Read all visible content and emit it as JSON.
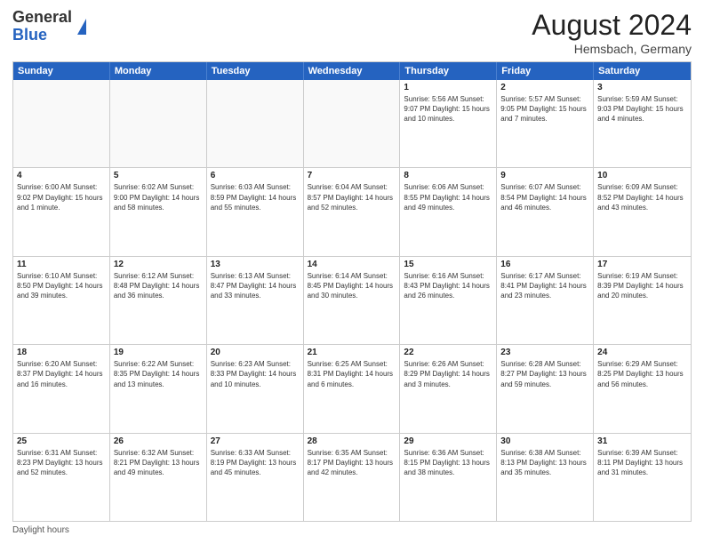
{
  "header": {
    "logo": {
      "line1": "General",
      "line2": "Blue"
    },
    "title": "August 2024",
    "subtitle": "Hemsbach, Germany"
  },
  "days_of_week": [
    "Sunday",
    "Monday",
    "Tuesday",
    "Wednesday",
    "Thursday",
    "Friday",
    "Saturday"
  ],
  "weeks": [
    [
      {
        "day": "",
        "empty": true
      },
      {
        "day": "",
        "empty": true
      },
      {
        "day": "",
        "empty": true
      },
      {
        "day": "",
        "empty": true
      },
      {
        "day": "1",
        "info": "Sunrise: 5:56 AM\nSunset: 9:07 PM\nDaylight: 15 hours\nand 10 minutes."
      },
      {
        "day": "2",
        "info": "Sunrise: 5:57 AM\nSunset: 9:05 PM\nDaylight: 15 hours\nand 7 minutes."
      },
      {
        "day": "3",
        "info": "Sunrise: 5:59 AM\nSunset: 9:03 PM\nDaylight: 15 hours\nand 4 minutes."
      }
    ],
    [
      {
        "day": "4",
        "info": "Sunrise: 6:00 AM\nSunset: 9:02 PM\nDaylight: 15 hours\nand 1 minute."
      },
      {
        "day": "5",
        "info": "Sunrise: 6:02 AM\nSunset: 9:00 PM\nDaylight: 14 hours\nand 58 minutes."
      },
      {
        "day": "6",
        "info": "Sunrise: 6:03 AM\nSunset: 8:59 PM\nDaylight: 14 hours\nand 55 minutes."
      },
      {
        "day": "7",
        "info": "Sunrise: 6:04 AM\nSunset: 8:57 PM\nDaylight: 14 hours\nand 52 minutes."
      },
      {
        "day": "8",
        "info": "Sunrise: 6:06 AM\nSunset: 8:55 PM\nDaylight: 14 hours\nand 49 minutes."
      },
      {
        "day": "9",
        "info": "Sunrise: 6:07 AM\nSunset: 8:54 PM\nDaylight: 14 hours\nand 46 minutes."
      },
      {
        "day": "10",
        "info": "Sunrise: 6:09 AM\nSunset: 8:52 PM\nDaylight: 14 hours\nand 43 minutes."
      }
    ],
    [
      {
        "day": "11",
        "info": "Sunrise: 6:10 AM\nSunset: 8:50 PM\nDaylight: 14 hours\nand 39 minutes."
      },
      {
        "day": "12",
        "info": "Sunrise: 6:12 AM\nSunset: 8:48 PM\nDaylight: 14 hours\nand 36 minutes."
      },
      {
        "day": "13",
        "info": "Sunrise: 6:13 AM\nSunset: 8:47 PM\nDaylight: 14 hours\nand 33 minutes."
      },
      {
        "day": "14",
        "info": "Sunrise: 6:14 AM\nSunset: 8:45 PM\nDaylight: 14 hours\nand 30 minutes."
      },
      {
        "day": "15",
        "info": "Sunrise: 6:16 AM\nSunset: 8:43 PM\nDaylight: 14 hours\nand 26 minutes."
      },
      {
        "day": "16",
        "info": "Sunrise: 6:17 AM\nSunset: 8:41 PM\nDaylight: 14 hours\nand 23 minutes."
      },
      {
        "day": "17",
        "info": "Sunrise: 6:19 AM\nSunset: 8:39 PM\nDaylight: 14 hours\nand 20 minutes."
      }
    ],
    [
      {
        "day": "18",
        "info": "Sunrise: 6:20 AM\nSunset: 8:37 PM\nDaylight: 14 hours\nand 16 minutes."
      },
      {
        "day": "19",
        "info": "Sunrise: 6:22 AM\nSunset: 8:35 PM\nDaylight: 14 hours\nand 13 minutes."
      },
      {
        "day": "20",
        "info": "Sunrise: 6:23 AM\nSunset: 8:33 PM\nDaylight: 14 hours\nand 10 minutes."
      },
      {
        "day": "21",
        "info": "Sunrise: 6:25 AM\nSunset: 8:31 PM\nDaylight: 14 hours\nand 6 minutes."
      },
      {
        "day": "22",
        "info": "Sunrise: 6:26 AM\nSunset: 8:29 PM\nDaylight: 14 hours\nand 3 minutes."
      },
      {
        "day": "23",
        "info": "Sunrise: 6:28 AM\nSunset: 8:27 PM\nDaylight: 13 hours\nand 59 minutes."
      },
      {
        "day": "24",
        "info": "Sunrise: 6:29 AM\nSunset: 8:25 PM\nDaylight: 13 hours\nand 56 minutes."
      }
    ],
    [
      {
        "day": "25",
        "info": "Sunrise: 6:31 AM\nSunset: 8:23 PM\nDaylight: 13 hours\nand 52 minutes."
      },
      {
        "day": "26",
        "info": "Sunrise: 6:32 AM\nSunset: 8:21 PM\nDaylight: 13 hours\nand 49 minutes."
      },
      {
        "day": "27",
        "info": "Sunrise: 6:33 AM\nSunset: 8:19 PM\nDaylight: 13 hours\nand 45 minutes."
      },
      {
        "day": "28",
        "info": "Sunrise: 6:35 AM\nSunset: 8:17 PM\nDaylight: 13 hours\nand 42 minutes."
      },
      {
        "day": "29",
        "info": "Sunrise: 6:36 AM\nSunset: 8:15 PM\nDaylight: 13 hours\nand 38 minutes."
      },
      {
        "day": "30",
        "info": "Sunrise: 6:38 AM\nSunset: 8:13 PM\nDaylight: 13 hours\nand 35 minutes."
      },
      {
        "day": "31",
        "info": "Sunrise: 6:39 AM\nSunset: 8:11 PM\nDaylight: 13 hours\nand 31 minutes."
      }
    ]
  ],
  "footer": {
    "note": "Daylight hours"
  }
}
